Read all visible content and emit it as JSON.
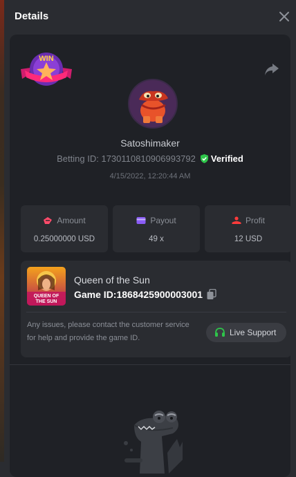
{
  "header": {
    "title": "Details"
  },
  "bet": {
    "username": "Satoshimaker",
    "betting_id_label": "Betting ID:",
    "betting_id": "1730110810906993792",
    "verified": "Verified",
    "timestamp": "4/15/2022, 12:20:44 AM"
  },
  "stats": {
    "amount_label": "Amount",
    "amount_value": "0.25000000 USD",
    "payout_label": "Payout",
    "payout_value": "49 x",
    "profit_label": "Profit",
    "profit_value": "12 USD"
  },
  "game": {
    "name": "Queen of the Sun",
    "id_label": "Game ID:",
    "id": "1868425900003001",
    "notice": "Any issues, please contact the customer service for help and provide the game ID.",
    "support_label": "Live Support",
    "thumb_text_line1": "QUEEN OF",
    "thumb_text_line2": "THE SUN"
  },
  "badge": {
    "text": "WIN"
  },
  "colors": {
    "accent_green": "#2ec54a",
    "amount_icon": "#ff4b6a",
    "payout_icon": "#8a5cf6",
    "profit_icon": "#ff3b3b"
  },
  "icons": {
    "close": "close-icon",
    "share": "share-icon",
    "verified": "verified-check-icon",
    "copy": "copy-icon",
    "support": "headset-icon"
  }
}
